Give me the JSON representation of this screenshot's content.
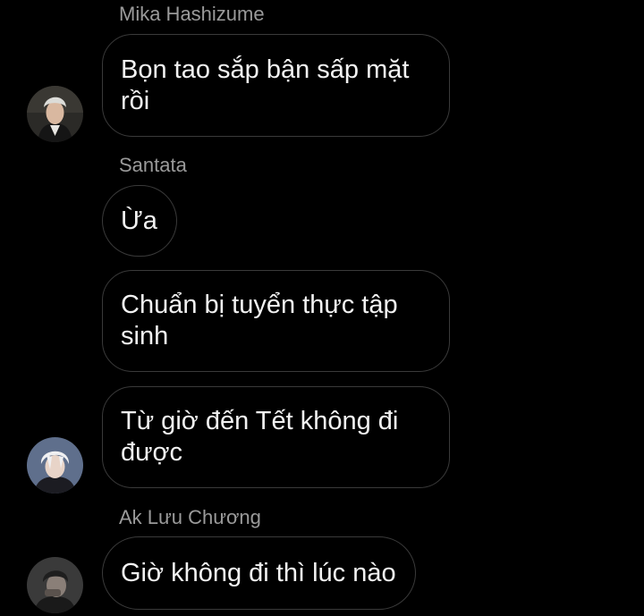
{
  "thread": {
    "groups": [
      {
        "sender": "Mika Hashizume",
        "avatar_icon": "user-avatar-silver-hair",
        "messages": [
          "Bọn tao sắp bận sấp mặt rồi"
        ]
      },
      {
        "sender": "Santata",
        "avatar_icon": "user-avatar-white-hair",
        "messages": [
          "Ừa",
          "Chuẩn bị tuyển thực tập sinh",
          "Từ giờ đến Tết không đi được"
        ]
      },
      {
        "sender": "Ak Lưu Chương",
        "avatar_icon": "user-avatar-dark",
        "messages": [
          "Giờ không đi thì lúc nào"
        ]
      }
    ]
  },
  "colors": {
    "background": "#000000",
    "bubble_border": "#3a3a3a",
    "message_text": "#f2f2f2",
    "sender_text": "#9a9a9a"
  }
}
